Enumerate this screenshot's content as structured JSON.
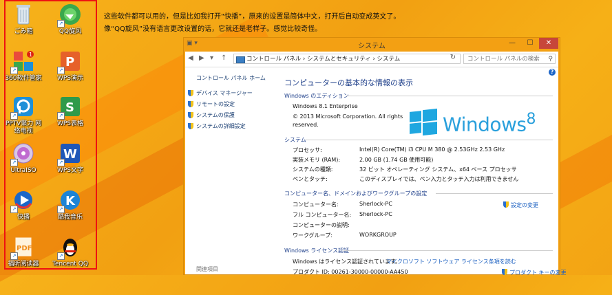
{
  "desktop": {
    "icons": [
      {
        "label": "ごみ箱",
        "icon": "recycle-bin-icon",
        "color": "#9fb6c8"
      },
      {
        "label": "QQ旋风",
        "icon": "qq-whirlwind-icon",
        "color": "#3aa84d"
      },
      {
        "label": "360软件管家",
        "icon": "software-manager-icon",
        "color": "#e94b3c"
      },
      {
        "label": "WPS演示",
        "icon": "wps-presentation-icon",
        "color": "#e6612a"
      },
      {
        "label": "PPTV聚力 网络电视",
        "icon": "pptv-icon",
        "color": "#1e90d8"
      },
      {
        "label": "WPS表格",
        "icon": "wps-spreadsheet-icon",
        "color": "#2f9a4a"
      },
      {
        "label": "UltraISO",
        "icon": "ultraiso-icon",
        "color": "#c06ad0"
      },
      {
        "label": "WPS文字",
        "icon": "wps-writer-icon",
        "color": "#1f57b8"
      },
      {
        "label": "快播",
        "icon": "qvod-player-icon",
        "color": "#1a66c8"
      },
      {
        "label": "酷我音乐",
        "icon": "kuwo-music-icon",
        "color": "#1d84d6"
      },
      {
        "label": "福昕阅读器",
        "icon": "pdf-reader-icon",
        "color": "#f08c1a"
      },
      {
        "label": "Tencent QQ",
        "icon": "qq-penguin-icon",
        "color": "#111111"
      }
    ]
  },
  "caption": {
    "line1": "这些软件都可以用的，但是比如我打开“快播”，原来的设置是简体中文，打开后自动变成英文了。",
    "line2": "像“QQ旋风”没有语言更改设置的话，它就还是老样子。感觉比较奇怪。"
  },
  "window": {
    "title": "システム",
    "min": "—",
    "max": "☐",
    "close": "✕",
    "nav": {
      "back": "◀",
      "forward": "▶",
      "up": "↑"
    },
    "address": "コントロール パネル  ›  システムとセキュリティ  ›  システム",
    "refresh": "↻",
    "search_placeholder": "コントロール パネルの検索",
    "help": "?",
    "sidebar": {
      "home": "コントロール パネル ホーム",
      "links": [
        "デバイス マネージャー",
        "リモートの設定",
        "システムの保護",
        "システムの詳細設定"
      ],
      "related": "関連項目"
    },
    "heading": "コンピューターの基本的な情報の表示",
    "edition": {
      "section": "Windows のエディション",
      "name": "Windows 8.1 Enterprise",
      "copyright": "© 2013 Microsoft Corporation. All rights",
      "copyright2": "reserved.",
      "logo_text": "Windows",
      "logo_num": "8"
    },
    "system": {
      "section": "システム",
      "rows": [
        {
          "label": "プロセッサ:",
          "value": "Intel(R) Core(TM) i3 CPU       M 380  @ 2.53GHz   2.53 GHz"
        },
        {
          "label": "実装メモリ (RAM):",
          "value": "2.00 GB (1.74 GB 使用可能)"
        },
        {
          "label": "システムの種類:",
          "value": "32 ビット オペレーティング システム、x64 ベース プロセッサ"
        },
        {
          "label": "ペンとタッチ:",
          "value": "このディスプレイでは、ペン入力とタッチ入力は利用できません"
        }
      ]
    },
    "computer": {
      "section": "コンピューター名、ドメインおよびワークグループの設定",
      "change": "設定の変更",
      "rows": [
        {
          "label": "コンピューター名:",
          "value": "Sherlock-PC"
        },
        {
          "label": "フル コンピューター名:",
          "value": "Sherlock-PC"
        },
        {
          "label": "コンピューターの説明:",
          "value": ""
        },
        {
          "label": "ワークグループ:",
          "value": "WORKGROUP"
        }
      ]
    },
    "license": {
      "section": "Windows ライセンス認証",
      "status": "Windows はライセンス認証されています。",
      "link": "マイクロソフト ソフトウェア ライセンス条項を読む",
      "product_id": "プロダクト ID: 00261-30000-00000-AA450",
      "product_link": "プロダクト キーの変更"
    }
  }
}
